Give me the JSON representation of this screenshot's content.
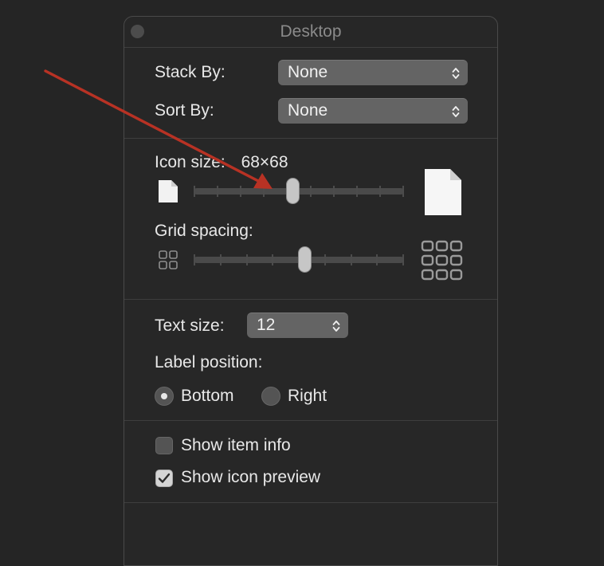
{
  "window": {
    "title": "Desktop"
  },
  "stack_by": {
    "label": "Stack By:",
    "value": "None"
  },
  "sort_by": {
    "label": "Sort By:",
    "value": "None"
  },
  "icon_size": {
    "label": "Icon size:",
    "value": "68×68",
    "level": 0.47,
    "ticks": 10
  },
  "grid_spacing": {
    "label": "Grid spacing:",
    "level": 0.53,
    "ticks": 9
  },
  "text_size": {
    "label": "Text size:",
    "value": "12"
  },
  "label_position": {
    "label": "Label position:",
    "options": [
      {
        "label": "Bottom",
        "selected": true
      },
      {
        "label": "Right",
        "selected": false
      }
    ]
  },
  "show_item_info": {
    "label": "Show item info",
    "checked": false
  },
  "show_icon_preview": {
    "label": "Show icon preview",
    "checked": true
  },
  "colors": {
    "annotation_arrow": "#b83224",
    "background": "#252525",
    "panel": "#272727"
  },
  "icons": [
    "close-button",
    "chevron-up-down-icon",
    "small-document-icon",
    "large-document-icon",
    "small-grid-icon",
    "large-grid-icon",
    "checkmark-icon",
    "annotation-arrow"
  ]
}
